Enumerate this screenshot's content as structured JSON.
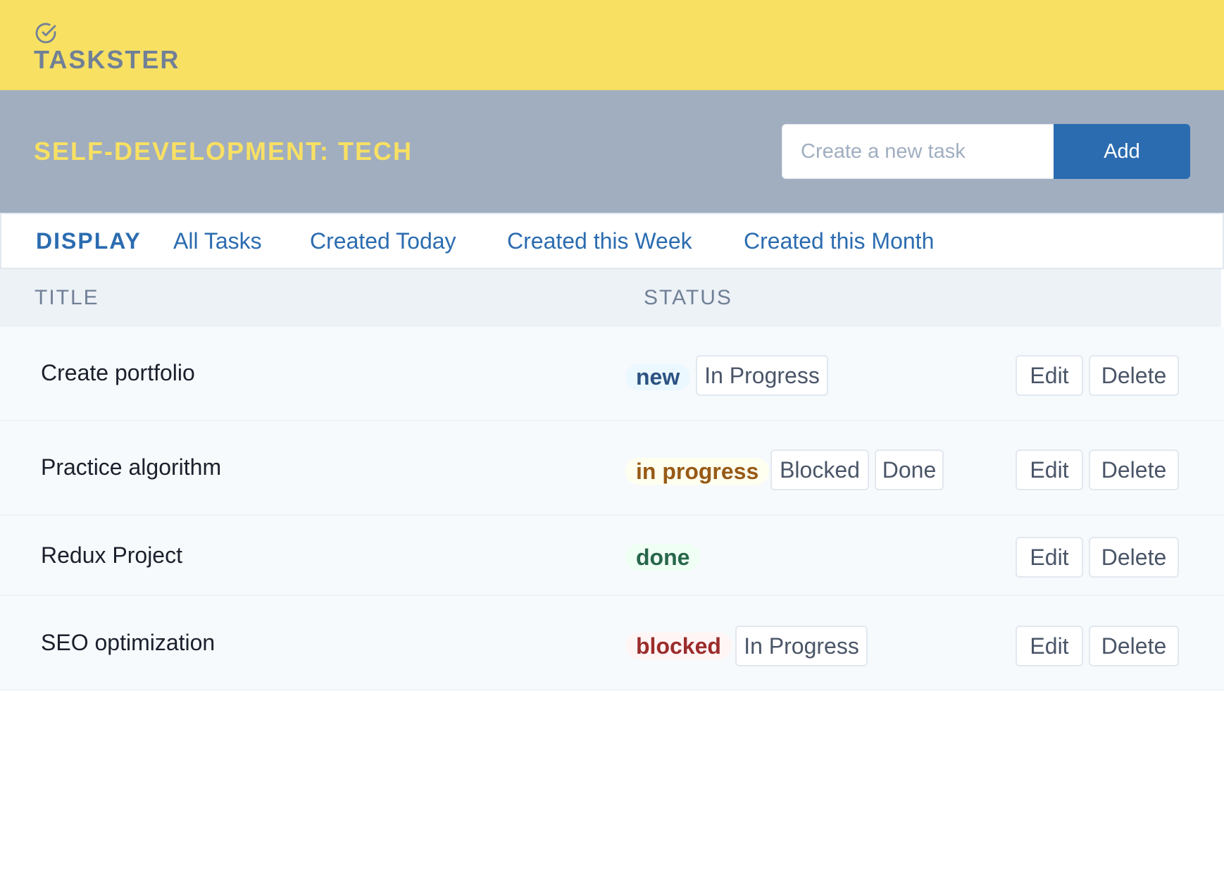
{
  "app": {
    "name": "TASKSTER",
    "logo_icon": "check-circle-icon",
    "brand_color": "#f8e063",
    "accent_color": "#2b6cb0"
  },
  "project": {
    "title": "SELF-DEVELOPMENT: TECH"
  },
  "new_task": {
    "placeholder": "Create a new task",
    "value": "",
    "add_label": "Add"
  },
  "filters": {
    "label": "DISPLAY",
    "options": [
      "All Tasks",
      "Created Today",
      "Created this Week",
      "Created this Month"
    ]
  },
  "table": {
    "columns": [
      "TITLE",
      "STATUS"
    ],
    "rows": [
      {
        "title": "Create portfolio",
        "status": "new",
        "transitions": [
          "In Progress"
        ],
        "actions": [
          "Edit",
          "Delete"
        ]
      },
      {
        "title": "Practice algorithm",
        "status": "in progress",
        "transitions": [
          "Blocked",
          "Done"
        ],
        "actions": [
          "Edit",
          "Delete"
        ]
      },
      {
        "title": "Redux Project",
        "status": "done",
        "transitions": [],
        "actions": [
          "Edit",
          "Delete"
        ]
      },
      {
        "title": "SEO optimization",
        "status": "blocked",
        "transitions": [
          "In Progress"
        ],
        "actions": [
          "Edit",
          "Delete"
        ]
      }
    ]
  },
  "status_colors": {
    "new": "#2c5282",
    "in progress": "#975a16",
    "done": "#276749",
    "blocked": "#9b2c2c"
  }
}
